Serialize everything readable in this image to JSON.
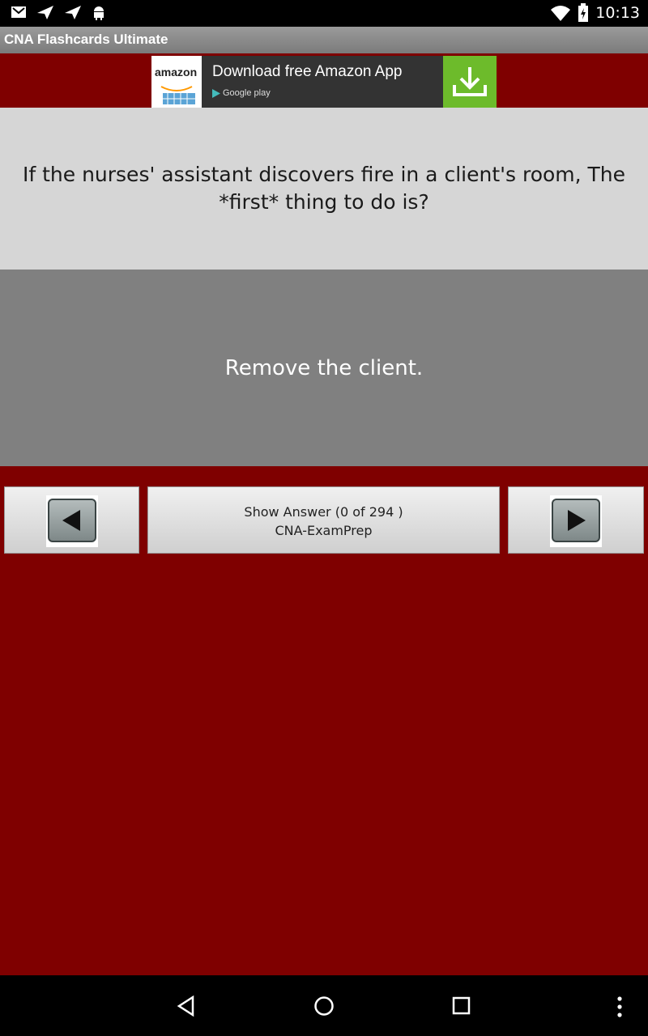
{
  "status_bar": {
    "time": "10:13",
    "left_icons": [
      "gmail-icon",
      "send-icon",
      "send-icon",
      "android-icon"
    ],
    "right_icons": [
      "wifi-icon",
      "battery-icon"
    ]
  },
  "app": {
    "title": "CNA Flashcards Ultimate"
  },
  "ad": {
    "logo_text": "amazon",
    "title": "Download free Amazon App",
    "store": "Google play"
  },
  "card": {
    "question": "If the nurses' assistant discovers fire in a client's room, The *first* thing to do is?",
    "answer": "Remove the client."
  },
  "controls": {
    "show_answer_line1": "Show Answer  (0 of 294 )",
    "show_answer_line2": "CNA-ExamPrep"
  },
  "colors": {
    "background": "#7f0000",
    "question_bg": "#d6d6d6",
    "answer_bg": "#808080"
  }
}
